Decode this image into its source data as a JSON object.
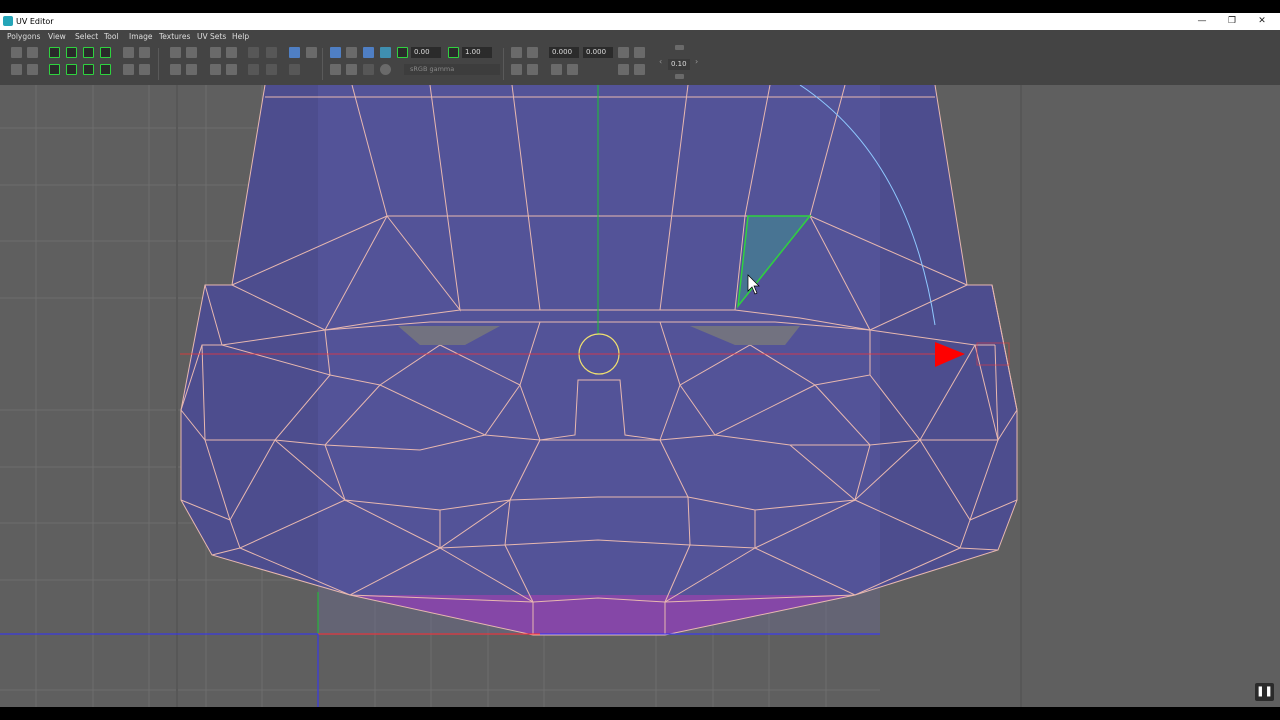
{
  "window": {
    "title": "UV Editor",
    "minimize": "—",
    "restore": "❐",
    "close": "✕"
  },
  "menu": [
    "Polygons",
    "View",
    "Select",
    "Tool",
    "Image",
    "Textures",
    "UV Sets",
    "Help"
  ],
  "toolbar": {
    "field_1": "0.00",
    "field_2": "1.00",
    "field_3": "0.000",
    "field_4": "0.000",
    "step_value": "0.10",
    "color_space": "sRGB gamma"
  },
  "colors": {
    "viewport_bg": "#5f5f5f",
    "uv_shell_fill": "#4c4c90",
    "uv_edge": "#e8b8b0",
    "selected_face": "#2fd23f",
    "v_axis": "#19c632",
    "u_arrow": "#ff0000",
    "u_axis_line": "#3030ff"
  },
  "icons": [
    "select-icon",
    "lasso-icon",
    "move-icon",
    "rotate-icon",
    "scale-icon",
    "flip-icon",
    "grid-icon",
    "checker-icon",
    "display-icon",
    "pause-icon"
  ]
}
